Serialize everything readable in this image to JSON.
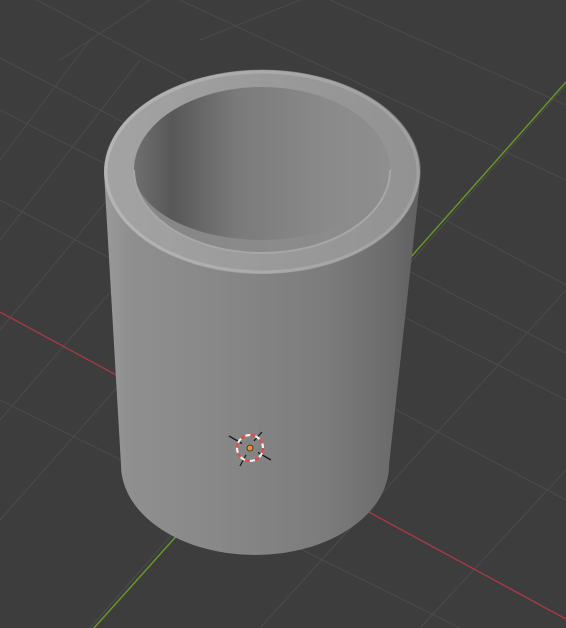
{
  "viewport": {
    "view": "3D Viewport",
    "background_color": "#3d3d3d",
    "grid_line_color": "#4b4b4b",
    "axis_colors": {
      "x": "#a33a46",
      "y": "#6a9a22"
    },
    "object": {
      "shape": "hollow cylinder",
      "shading": "solid",
      "color": "#8e8e8e"
    },
    "cursor": {
      "icon": "3d-cursor-icon",
      "ring_colors": [
        "#e34b4b",
        "#f0f0f0"
      ]
    },
    "origin_dot_color": "#f08f2a"
  }
}
